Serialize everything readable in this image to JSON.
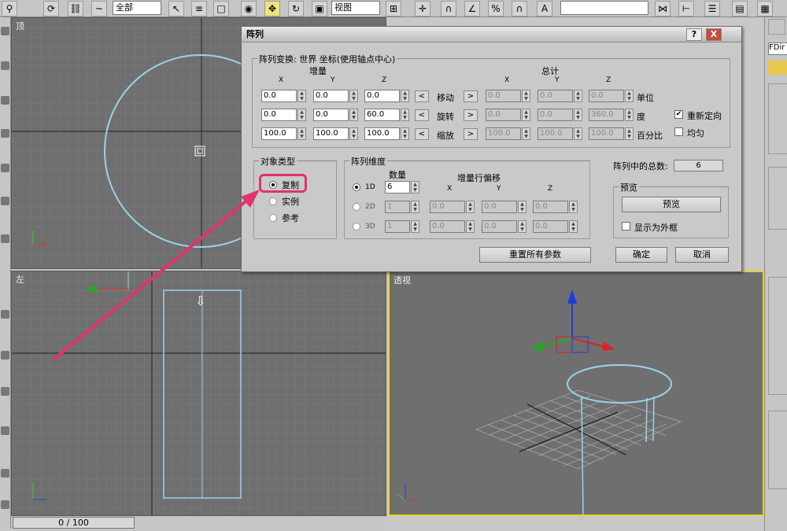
{
  "toolbar": {
    "selection_filter": "全部",
    "ref_coord": "视图"
  },
  "viewports": {
    "top": {
      "label": "顶"
    },
    "left": {
      "label": "左"
    },
    "persp": {
      "label": "透视"
    }
  },
  "right_panel": {
    "object_name": "FDir"
  },
  "timeline": {
    "frame": "0 / 100"
  },
  "dialog": {
    "title": "阵列",
    "help_btn": "?",
    "close_btn": "X",
    "transform_title": "阵列变换: 世界 坐标(使用轴点中心)",
    "incr_header": "增量",
    "total_header": "总计",
    "axis_x": "X",
    "axis_y": "Y",
    "axis_z": "Z",
    "rows": [
      {
        "label": "移动",
        "unit": "单位",
        "incr": [
          "0.0",
          "0.0",
          "0.0"
        ],
        "total": [
          "0.0",
          "0.0",
          "0.0"
        ]
      },
      {
        "label": "旋转",
        "unit": "度",
        "incr": [
          "0.0",
          "0.0",
          "60.0"
        ],
        "total": [
          "0.0",
          "0.0",
          "360.0"
        ]
      },
      {
        "label": "缩放",
        "unit": "百分比",
        "incr": [
          "100.0",
          "100.0",
          "100.0"
        ],
        "total": [
          "100.0",
          "100.0",
          "100.0"
        ]
      }
    ],
    "reorient": "重新定向",
    "uniform": "均匀",
    "object_type": {
      "title": "对象类型",
      "copy": "复制",
      "instance": "实例",
      "reference": "参考",
      "selected": "copy"
    },
    "dimensions": {
      "title": "阵列维度",
      "count_header": "数量",
      "offset_header": "增量行偏移",
      "rows": [
        {
          "label": "1D",
          "count": "6",
          "offsets": []
        },
        {
          "label": "2D",
          "count": "1",
          "offsets": [
            "0.0",
            "0.0",
            "0.0"
          ]
        },
        {
          "label": "3D",
          "count": "1",
          "offsets": [
            "0.0",
            "0.0",
            "0.0"
          ]
        }
      ]
    },
    "total_label": "阵列中的总数:",
    "total_value": "6",
    "preview_group": "预览",
    "preview_btn": "预览",
    "show_box": "显示为外框",
    "reset_btn": "重置所有参数",
    "ok_btn": "确定",
    "cancel_btn": "取消"
  },
  "colors": {
    "highlight": "#e0336f",
    "active_viewport": "#e8d428"
  }
}
